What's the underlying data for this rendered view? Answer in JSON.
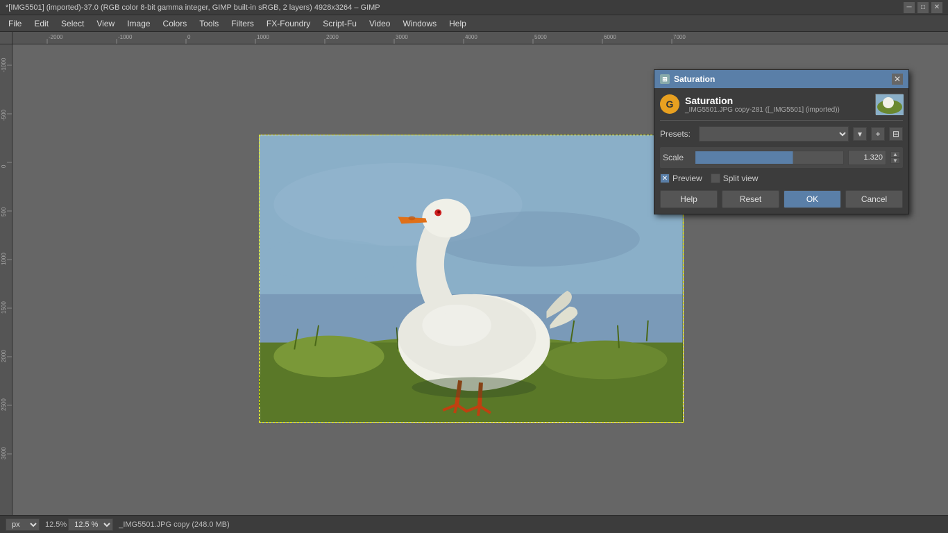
{
  "window": {
    "title": "*[IMG5501] (imported)-37.0 (RGB color 8-bit gamma integer, GIMP built-in sRGB, 2 layers) 4928x3264 – GIMP",
    "close_btn": "✕",
    "minimize_btn": "─",
    "maximize_btn": "□"
  },
  "menu": {
    "items": [
      "File",
      "Edit",
      "Select",
      "View",
      "Image",
      "Colors",
      "Tools",
      "Filters",
      "FX-Foundry",
      "Script-Fu",
      "Video",
      "Windows",
      "Help"
    ]
  },
  "ruler": {
    "ticks": [
      "-2000",
      "-1000",
      "0",
      "1000",
      "2000",
      "3000",
      "4000",
      "5000",
      "6000",
      "7000"
    ]
  },
  "dialog": {
    "title": "Saturation",
    "close_btn": "✕",
    "gimp_icon": "G",
    "header_title": "Saturation",
    "header_subtitle": "_IMG5501.JPG copy-281 ([_IMG5501] (imported))",
    "presets_label": "Presets:",
    "presets_placeholder": "",
    "scale_label": "Scale",
    "scale_value": "1.320",
    "preview_label": "Preview",
    "split_view_label": "Split view",
    "buttons": {
      "help": "Help",
      "reset": "Reset",
      "ok": "OK",
      "cancel": "Cancel"
    }
  },
  "status_bar": {
    "unit": "px",
    "zoom": "12.5",
    "zoom_symbol": "%",
    "filename": "_IMG5501.JPG copy (248.0 MB)"
  }
}
